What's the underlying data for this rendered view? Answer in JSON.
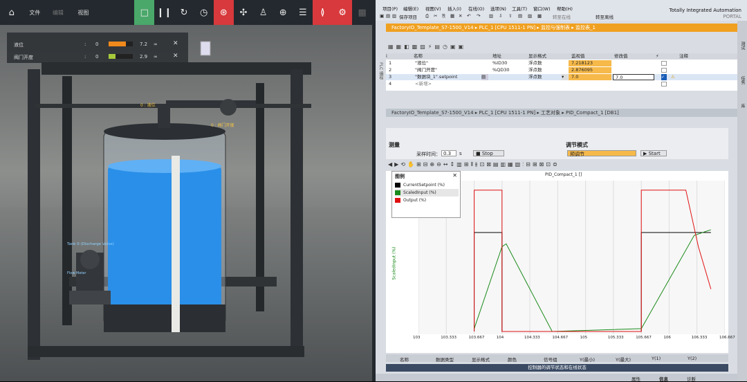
{
  "sim": {
    "menu": [
      "文件",
      "编辑",
      "视图"
    ],
    "icons": [
      "home-icon",
      "stop-icon",
      "pause-icon",
      "reset-icon",
      "timer-icon",
      "sensor-icon",
      "fan-icon",
      "person-icon",
      "crosshair-icon",
      "list-icon",
      "signal-icon",
      "gears-icon",
      "grid-icon"
    ],
    "watch": [
      {
        "label": "液位",
        "colon": ":",
        "min": "0",
        "value": "7.2",
        "fill": 0.72,
        "color": "#f08a1c"
      },
      {
        "label": "阀门开度",
        "colon": ":",
        "min": "0",
        "value": "2.9",
        "fill": 0.29,
        "color": "#a6c93a"
      }
    ],
    "tags": {
      "level": "0 : 液位",
      "valve": "0 : 阀门开度",
      "tank": "Tank 0 (Discharge Valve)",
      "flow": "Flow Meter"
    }
  },
  "tia": {
    "menu": [
      "项目(P)",
      "编辑(E)",
      "视图(V)",
      "插入(I)",
      "在线(O)",
      "选项(N)",
      "工具(T)",
      "窗口(W)",
      "帮助(H)"
    ],
    "save": "保存项目",
    "online": "转至在线",
    "offline": "转至离线",
    "brand1": "Totally Integrated Automation",
    "brand2": "PORTAL",
    "path1": "FactoryIO_Template_S7-1500_V14  ▸  PLC_1 [CPU 1511-1 PN]  ▸  监控与强制表  ▸  监控表_1",
    "path2": "FactoryIO_Template_S7-1500_V14  ▸  PLC_1 [CPU 1511-1 PN]  ▸  工艺对象  ▸  PID_Compact_1 [DB1]",
    "plc_side": "PLC 编程",
    "cols": [
      "i",
      "名称",
      "地址",
      "显示格式",
      "监视值",
      "修改值",
      "",
      "注释"
    ],
    "rows": [
      {
        "n": "1",
        "name": "\"液位\"",
        "addr": "%ID30",
        "fmt": "浮点数",
        "mon": "7.218123",
        "mod": ""
      },
      {
        "n": "2",
        "name": "\"阀门开度\"",
        "addr": "%QD30",
        "fmt": "浮点数",
        "mon": "2.876095",
        "mod": ""
      },
      {
        "n": "3",
        "name": "\"数据块_1\".setpoint",
        "addr": "",
        "fmt": "浮点数",
        "mon": "7.0",
        "mod": "7.0"
      },
      {
        "n": "4",
        "name": "<新增>",
        "addr": "",
        "fmt": "",
        "mon": "",
        "mod": ""
      }
    ],
    "measure": "测量",
    "sample_label": "采样时间：",
    "sample_val": "0.3",
    "sample_unit": "s",
    "stop": "Stop",
    "mode_label": "调节模式",
    "mode_val": "预调节",
    "start": "Start",
    "legend_title": "图例",
    "side_tabs": [
      "测试",
      "任务",
      "库"
    ],
    "bottom_cols": [
      "名称",
      "数据类型",
      "显示格式",
      "颜色",
      "信号组",
      "Y(最小)",
      "Y(最大)",
      "Y(1)",
      "Y(2)"
    ],
    "bottom_status": "控制器的调节状态和在线状态",
    "status_items": [
      "属性",
      "信息",
      "诊断"
    ]
  },
  "chart_data": {
    "type": "line",
    "title": "PID_Compact_1 []",
    "ylabel": "ScaledInput (%)",
    "xticks": [
      "103",
      "103.333",
      "103.667",
      "104",
      "104.333",
      "104.667",
      "105",
      "105.333",
      "105.667",
      "106",
      "106.333",
      "106.667"
    ],
    "legend": [
      {
        "name": "CurrentSetpoint (%)",
        "color": "#000000"
      },
      {
        "name": "ScaledInput (%)",
        "color": "#1a8a1a"
      },
      {
        "name": "Output (%)",
        "color": "#e01010"
      }
    ],
    "x_range": [
      103,
      106.667
    ],
    "series": [
      {
        "name": "CurrentSetpoint (%)",
        "points": [
          [
            103.667,
            0
          ],
          [
            103.667,
            70
          ],
          [
            104,
            70
          ],
          [
            104,
            0
          ],
          [
            105.667,
            0
          ],
          [
            105.667,
            70
          ],
          [
            106.5,
            70
          ]
        ]
      },
      {
        "name": "ScaledInput (%)",
        "points": [
          [
            103.667,
            2
          ],
          [
            104,
            60
          ],
          [
            104.05,
            62
          ],
          [
            104.6,
            0
          ],
          [
            105.667,
            2
          ],
          [
            106.3,
            68
          ],
          [
            106.5,
            72
          ]
        ]
      },
      {
        "name": "Output (%)",
        "points": [
          [
            103.667,
            0
          ],
          [
            103.667,
            100
          ],
          [
            104,
            100
          ],
          [
            104,
            0
          ],
          [
            105.667,
            0
          ],
          [
            105.667,
            100
          ],
          [
            106.2,
            100
          ],
          [
            106.35,
            60
          ],
          [
            106.5,
            30
          ]
        ]
      }
    ]
  }
}
